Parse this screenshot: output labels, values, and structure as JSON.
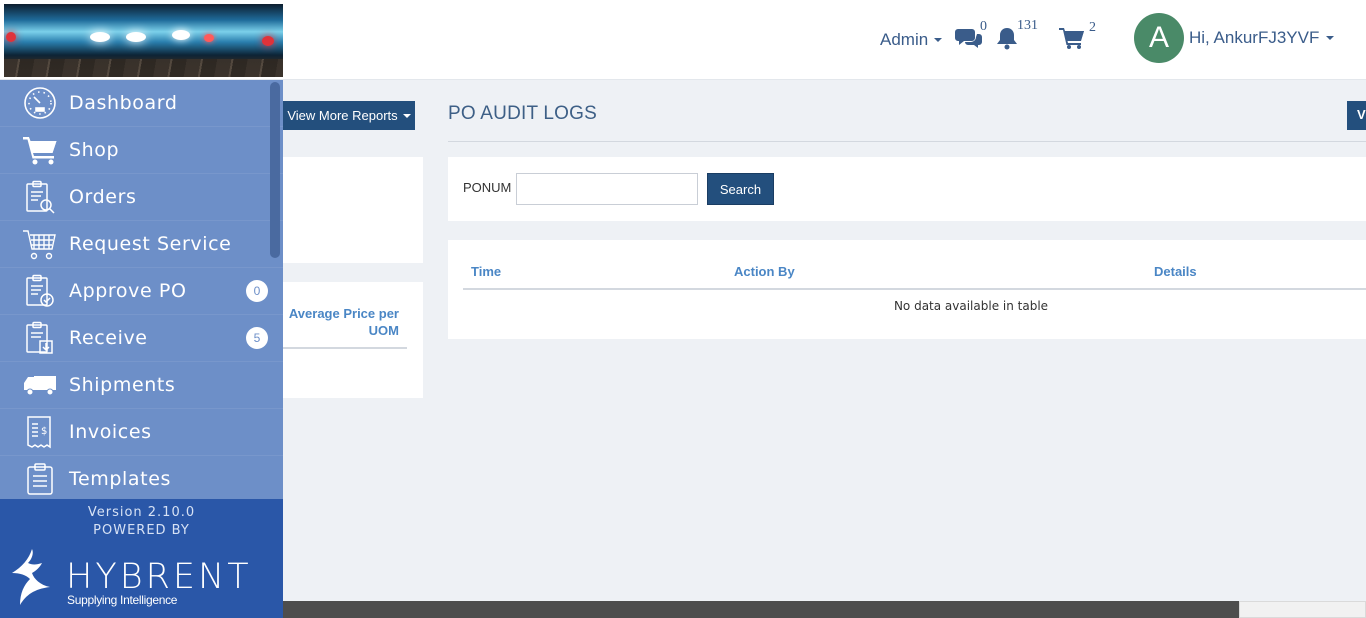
{
  "header": {
    "admin_label": "Admin",
    "messages_count": "0",
    "notifications_count": "131",
    "cart_count": "2",
    "avatar_initial": "A",
    "greeting": "Hi, AnkurFJ3YVF"
  },
  "sidebar": {
    "items": [
      {
        "label": "Dashboard",
        "icon": "dashboard-gauge-icon"
      },
      {
        "label": "Shop",
        "icon": "shopping-cart-icon"
      },
      {
        "label": "Orders",
        "icon": "orders-clipboard-search-icon"
      },
      {
        "label": "Request Service",
        "icon": "request-service-cart-icon"
      },
      {
        "label": "Approve PO",
        "icon": "approve-clipboard-check-icon",
        "badge": "0"
      },
      {
        "label": "Receive",
        "icon": "receive-clipboard-download-icon",
        "badge": "5"
      },
      {
        "label": "Shipments",
        "icon": "truck-icon"
      },
      {
        "label": "Invoices",
        "icon": "invoice-dollar-icon"
      },
      {
        "label": "Templates",
        "icon": "templates-clipboard-icon"
      }
    ],
    "version": "Version 2.10.0",
    "powered_by": "POWERED BY",
    "brand_name": "HYBRENT",
    "brand_tagline": "Supplying Intelligence"
  },
  "left_panel": {
    "view_more_reports": "View More Reports",
    "avg_price_header": "Average Price per UOM"
  },
  "main": {
    "title": "PO AUDIT LOGS",
    "right_button_partial": "V",
    "ponum_label": "PONUM",
    "ponum_value": "",
    "search_button": "Search",
    "columns": [
      "Time",
      "Action By",
      "Details"
    ],
    "empty_message": "No data available in table"
  },
  "colors": {
    "sidebar_bg": "#6d8fc8",
    "sidebar_footer": "#2a57a8",
    "primary_button": "#234f7d",
    "link_blue": "#4a86c5",
    "avatar_bg": "#4a8a68"
  }
}
